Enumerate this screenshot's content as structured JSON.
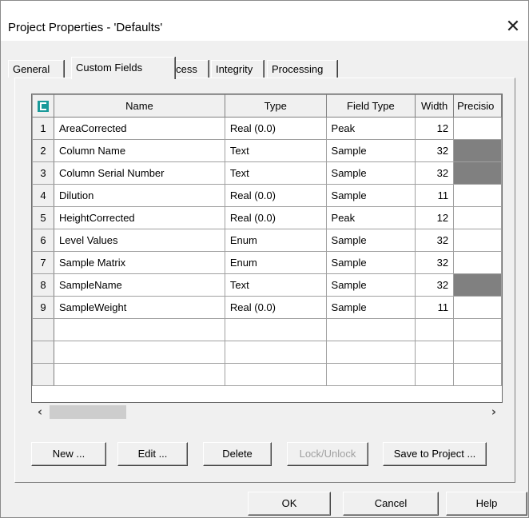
{
  "window": {
    "title": "Project Properties - 'Defaults'",
    "close_glyph": "✕"
  },
  "tabs": [
    {
      "label": "General"
    },
    {
      "label": "Custom Fields"
    },
    {
      "label": "Access"
    },
    {
      "label": "Integrity"
    },
    {
      "label": "Processing"
    }
  ],
  "grid": {
    "columns": [
      "Name",
      "Type",
      "Field Type",
      "Width",
      "Precisio"
    ],
    "rows": [
      {
        "n": "1",
        "name": "AreaCorrected",
        "type": "Real (0.0)",
        "field_type": "Peak",
        "width": "12",
        "precision_shaded": false
      },
      {
        "n": "2",
        "name": "Column Name",
        "type": "Text",
        "field_type": "Sample",
        "width": "32",
        "precision_shaded": true
      },
      {
        "n": "3",
        "name": "Column Serial Number",
        "type": "Text",
        "field_type": "Sample",
        "width": "32",
        "precision_shaded": true
      },
      {
        "n": "4",
        "name": "Dilution",
        "type": "Real (0.0)",
        "field_type": "Sample",
        "width": "11",
        "precision_shaded": false
      },
      {
        "n": "5",
        "name": "HeightCorrected",
        "type": "Real (0.0)",
        "field_type": "Peak",
        "width": "12",
        "precision_shaded": false
      },
      {
        "n": "6",
        "name": "Level Values",
        "type": "Enum",
        "field_type": "Sample",
        "width": "32",
        "precision_shaded": false
      },
      {
        "n": "7",
        "name": "Sample Matrix",
        "type": "Enum",
        "field_type": "Sample",
        "width": "32",
        "precision_shaded": false
      },
      {
        "n": "8",
        "name": "SampleName",
        "type": "Text",
        "field_type": "Sample",
        "width": "32",
        "precision_shaded": true
      },
      {
        "n": "9",
        "name": "SampleWeight",
        "type": "Real (0.0)",
        "field_type": "Sample",
        "width": "11",
        "precision_shaded": false
      }
    ],
    "shade_color": "#808080",
    "corner_icon_color": "#1a9a9a"
  },
  "scrollbar": {
    "left_glyph": "‹",
    "right_glyph": "›"
  },
  "actions": {
    "new": "New ...",
    "edit": "Edit ...",
    "delete": "Delete",
    "lock_unlock": "Lock/Unlock",
    "save_to_project": "Save to Project ..."
  },
  "dialog_buttons": {
    "ok": "OK",
    "cancel": "Cancel",
    "help": "Help"
  }
}
